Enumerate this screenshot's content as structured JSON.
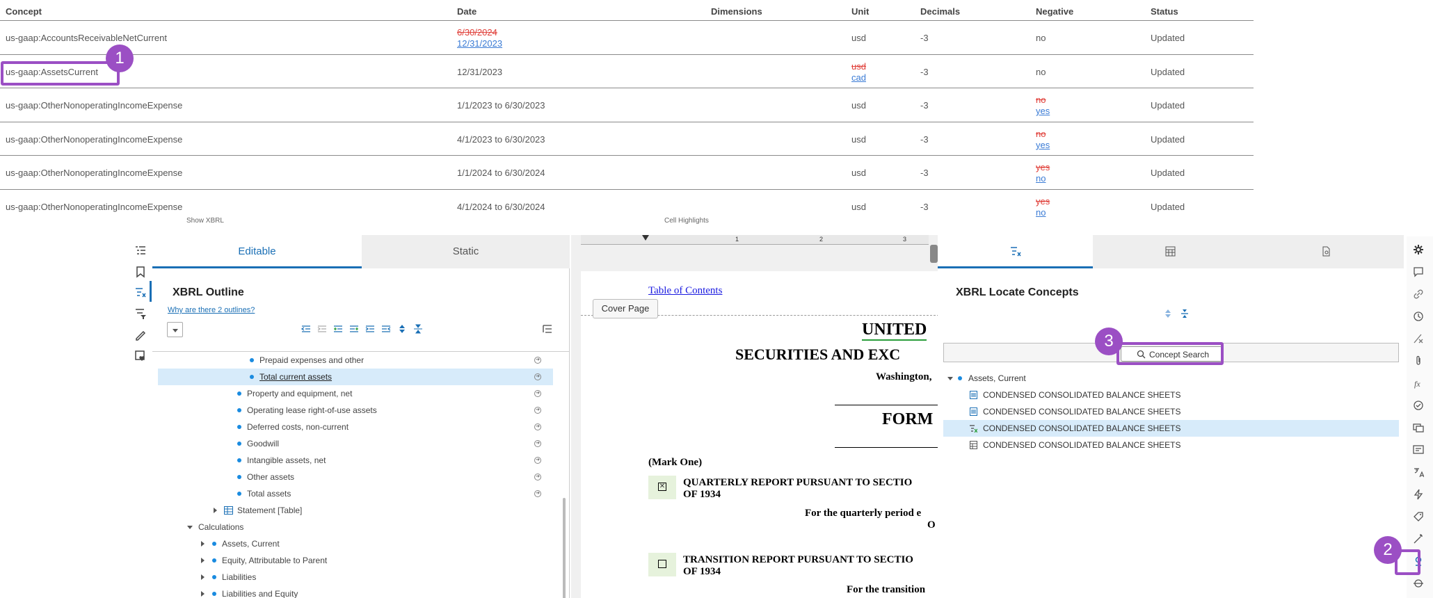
{
  "changes_table": {
    "headers": [
      "Concept",
      "Date",
      "Dimensions",
      "Unit",
      "Decimals",
      "Negative",
      "Status"
    ],
    "rows": [
      {
        "concept": "us-gaap:AccountsReceivableNetCurrent",
        "date_old": "6/30/2024",
        "date_new": "12/31/2023",
        "unit": "usd",
        "decimals": "-3",
        "negative": "no",
        "status": "Updated"
      },
      {
        "concept": "us-gaap:AssetsCurrent",
        "date": "12/31/2023",
        "unit_old": "usd",
        "unit_new": "cad",
        "decimals": "-3",
        "negative": "no",
        "status": "Updated"
      },
      {
        "concept": "us-gaap:OtherNonoperatingIncomeExpense",
        "date": "1/1/2023 to 6/30/2023",
        "unit": "usd",
        "decimals": "-3",
        "negative_old": "no",
        "negative_new": "yes",
        "status": "Updated"
      },
      {
        "concept": "us-gaap:OtherNonoperatingIncomeExpense",
        "date": "4/1/2023 to 6/30/2023",
        "unit": "usd",
        "decimals": "-3",
        "negative_old": "no",
        "negative_new": "yes",
        "status": "Updated"
      },
      {
        "concept": "us-gaap:OtherNonoperatingIncomeExpense",
        "date": "1/1/2024 to 6/30/2024",
        "unit": "usd",
        "decimals": "-3",
        "negative_old": "yes",
        "negative_new": "no",
        "status": "Updated"
      },
      {
        "concept": "us-gaap:OtherNonoperatingIncomeExpense",
        "date": "4/1/2024 to 6/30/2024",
        "unit": "usd",
        "decimals": "-3",
        "negative_old": "yes",
        "negative_new": "no",
        "status": "Updated"
      }
    ]
  },
  "callouts": [
    "1",
    "2",
    "3"
  ],
  "cut_labels": {
    "show_xbrl": "Show XBRL",
    "cell_highlights": "Cell Highlights"
  },
  "outline": {
    "tab_editable": "Editable",
    "tab_static": "Static",
    "title": "XBRL Outline",
    "help_link": "Why are there 2 outlines?",
    "items": [
      "Prepaid expenses and other",
      "Total current assets",
      "Property and equipment, net",
      "Operating lease right-of-use assets",
      "Deferred costs, non-current",
      "Goodwill",
      "Intangible assets, net",
      "Other assets",
      "Total assets",
      "Statement [Table]",
      "Calculations",
      "Assets, Current",
      "Equity, Attributable to Parent",
      "Liabilities",
      "Liabilities and Equity"
    ]
  },
  "document": {
    "ruler": [
      "1",
      "2",
      "3"
    ],
    "toc_link": "Table of Contents",
    "cover_page": "Cover Page",
    "heading1": "UNITED",
    "heading2": "SECURITIES AND EXC",
    "city": "Washington,",
    "form": "FORM",
    "mark_one": "(Mark One)",
    "quarterly_line1": "QUARTERLY REPORT PURSUANT TO SECTIO",
    "quarterly_line2": "OF 1934",
    "quarterly_period": "For the quarterly period e",
    "or_text": "O",
    "transition_line1": "TRANSITION REPORT PURSUANT TO SECTIO",
    "transition_line2": "OF 1934",
    "transition_period": "For the transition"
  },
  "locate": {
    "title": "XBRL Locate Concepts",
    "search_button": "Concept Search",
    "root": "Assets, Current",
    "results": [
      "CONDENSED CONSOLIDATED BALANCE SHEETS",
      "CONDENSED CONSOLIDATED BALANCE SHEETS",
      "CONDENSED CONSOLIDATED BALANCE SHEETS",
      "CONDENSED CONSOLIDATED BALANCE SHEETS"
    ]
  },
  "colors": {
    "accent": "#1a6fb5",
    "callout": "#9b4fc4",
    "removed": "#e0403a",
    "added": "#3a7bd5",
    "selection": "#d7ebfa"
  }
}
